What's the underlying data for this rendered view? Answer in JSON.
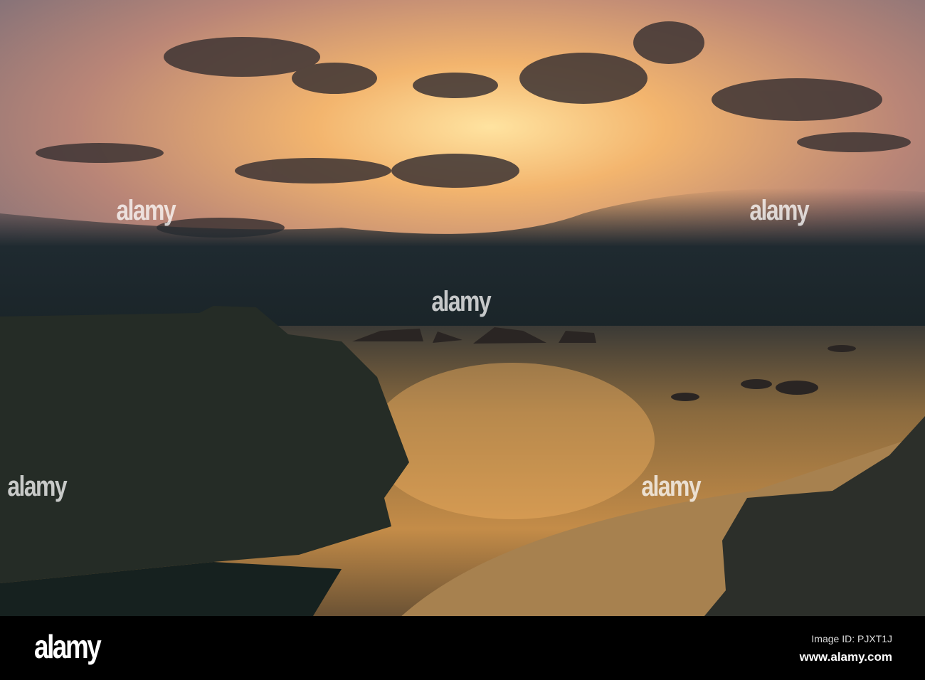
{
  "photo": {
    "subject": "sunset-over-rocky-coast"
  },
  "watermark": {
    "text": "alamy"
  },
  "footer": {
    "logo": "alamy",
    "image_id": "Image ID: PJXT1J",
    "url": "www.alamy.com"
  },
  "colors": {
    "sky_glow": "#f4b56a",
    "cloud": "#3a3535",
    "sea_dark": "#1c2a2e",
    "sand": "#b88a4f"
  }
}
